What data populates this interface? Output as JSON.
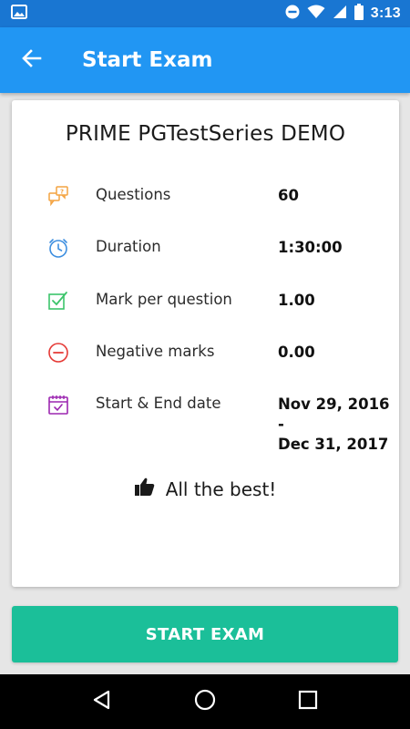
{
  "status_bar": {
    "time": "3:13",
    "icons": [
      "image-icon",
      "do-not-disturb-icon",
      "wifi-icon",
      "signal-icon",
      "battery-icon"
    ]
  },
  "app_bar": {
    "title": "Start Exam",
    "back_icon": "arrow-back-icon",
    "color": "#2196f3"
  },
  "exam": {
    "title": "PRIME PGTestSeries DEMO",
    "details": [
      {
        "icon": "questions-icon",
        "label": "Questions",
        "value": "60",
        "color": "#f4a340"
      },
      {
        "icon": "clock-icon",
        "label": "Duration",
        "value": "1:30:00",
        "color": "#3e8fe0"
      },
      {
        "icon": "checkbox-icon",
        "label": "Mark per question",
        "value": "1.00",
        "color": "#3cc46a"
      },
      {
        "icon": "minus-circle-icon",
        "label": "Negative marks",
        "value": "0.00",
        "color": "#e53935"
      },
      {
        "icon": "calendar-icon",
        "label": "Start & End date",
        "value_line1": "Nov 29, 2016 -",
        "value_line2": "Dec 31, 2017",
        "color": "#9c27b0"
      }
    ],
    "wish": "All the best!",
    "wish_icon": "thumbs-up-icon"
  },
  "start_button": {
    "label": "START EXAM",
    "color": "#1bbf99"
  },
  "nav_bar": {
    "icons": [
      "back-triangle-icon",
      "home-circle-icon",
      "recents-square-icon"
    ]
  }
}
